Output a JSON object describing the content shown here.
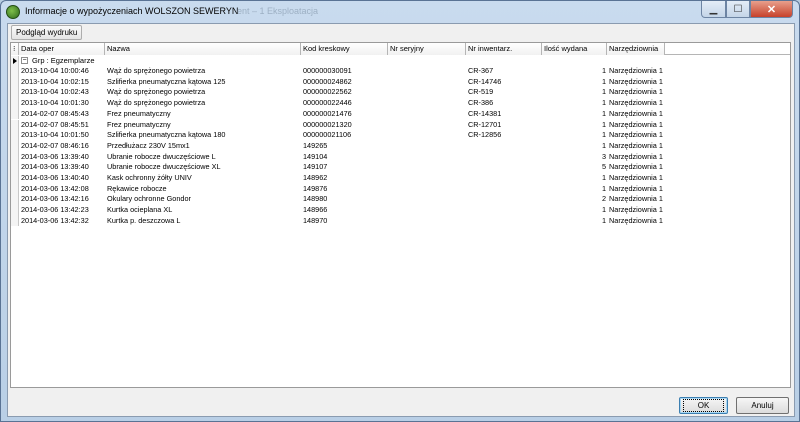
{
  "window": {
    "title": "Informacje o wypożyczeniach WOLSZON SEWERYN",
    "ghost_title": "ent – 1 Eksploatacja"
  },
  "toolbar": {
    "print_preview_label": "Podgląd wydruku"
  },
  "grid": {
    "columns": [
      "Data oper",
      "Nazwa",
      "Kod kreskowy",
      "Nr seryjny",
      "Nr inwentarz.",
      "Ilość wydana",
      "Narzędziownia"
    ],
    "group_label": "Grp : Egzemplarze",
    "rows": [
      {
        "date": "2013-10-04 10:00:46",
        "name": "Wąż do sprężonego powietrza",
        "barcode": "000000030091",
        "serial": "",
        "inventory": "CR-367",
        "qty": "1",
        "tool_room": "Narzędziownia 1"
      },
      {
        "date": "2013-10-04 10:02:15",
        "name": "Szlifierka pneumatyczna kątowa 125",
        "barcode": "000000024862",
        "serial": "",
        "inventory": "CR-14746",
        "qty": "1",
        "tool_room": "Narzędziownia 1"
      },
      {
        "date": "2013-10-04 10:02:43",
        "name": "Wąż do sprężonego powietrza",
        "barcode": "000000022562",
        "serial": "",
        "inventory": "CR-519",
        "qty": "1",
        "tool_room": "Narzędziownia 1"
      },
      {
        "date": "2013-10-04 10:01:30",
        "name": "Wąż do sprężonego powietrza",
        "barcode": "000000022446",
        "serial": "",
        "inventory": "CR-386",
        "qty": "1",
        "tool_room": "Narzędziownia 1"
      },
      {
        "date": "2014-02-07 08:45:43",
        "name": "Frez pneumatyczny",
        "barcode": "000000021476",
        "serial": "",
        "inventory": "CR-14381",
        "qty": "1",
        "tool_room": "Narzędziownia 1"
      },
      {
        "date": "2014-02-07 08:45:51",
        "name": "Frez pneumatyczny",
        "barcode": "000000021320",
        "serial": "",
        "inventory": "CR-12701",
        "qty": "1",
        "tool_room": "Narzędziownia 1"
      },
      {
        "date": "2013-10-04 10:01:50",
        "name": "Szlifierka pneumatyczna kątowa 180",
        "barcode": "000000021106",
        "serial": "",
        "inventory": "CR-12856",
        "qty": "1",
        "tool_room": "Narzędziownia 1"
      },
      {
        "date": "2014-02-07 08:46:16",
        "name": "Przedłużacz 230V 15mx1",
        "barcode": "149265",
        "serial": "",
        "inventory": "",
        "qty": "1",
        "tool_room": "Narzędziownia 1"
      },
      {
        "date": "2014-03-06 13:39:40",
        "name": "Ubranie robocze dwuczęściowe L",
        "barcode": "149104",
        "serial": "",
        "inventory": "",
        "qty": "3",
        "tool_room": "Narzędziownia 1"
      },
      {
        "date": "2014-03-06 13:39:40",
        "name": "Ubranie robocze dwuczęściowe XL",
        "barcode": "149107",
        "serial": "",
        "inventory": "",
        "qty": "5",
        "tool_room": "Narzędziownia 1"
      },
      {
        "date": "2014-03-06 13:40:40",
        "name": "Kask ochronny żółty UNIV",
        "barcode": "148962",
        "serial": "",
        "inventory": "",
        "qty": "1",
        "tool_room": "Narzędziownia 1"
      },
      {
        "date": "2014-03-06 13:42:08",
        "name": "Rękawice robocze",
        "barcode": "149876",
        "serial": "",
        "inventory": "",
        "qty": "1",
        "tool_room": "Narzędziownia 1"
      },
      {
        "date": "2014-03-06 13:42:16",
        "name": "Okulary ochronne Gondor",
        "barcode": "148980",
        "serial": "",
        "inventory": "",
        "qty": "2",
        "tool_room": "Narzędziownia 1"
      },
      {
        "date": "2014-03-06 13:42:23",
        "name": "Kurtka ocieplana XL",
        "barcode": "148966",
        "serial": "",
        "inventory": "",
        "qty": "1",
        "tool_room": "Narzędziownia 1"
      },
      {
        "date": "2014-03-06 13:42:32",
        "name": "Kurtka p. deszczowa L",
        "barcode": "148970",
        "serial": "",
        "inventory": "",
        "qty": "1",
        "tool_room": "Narzędziownia 1"
      }
    ]
  },
  "buttons": {
    "ok": "OK",
    "cancel": "Anuluj"
  }
}
